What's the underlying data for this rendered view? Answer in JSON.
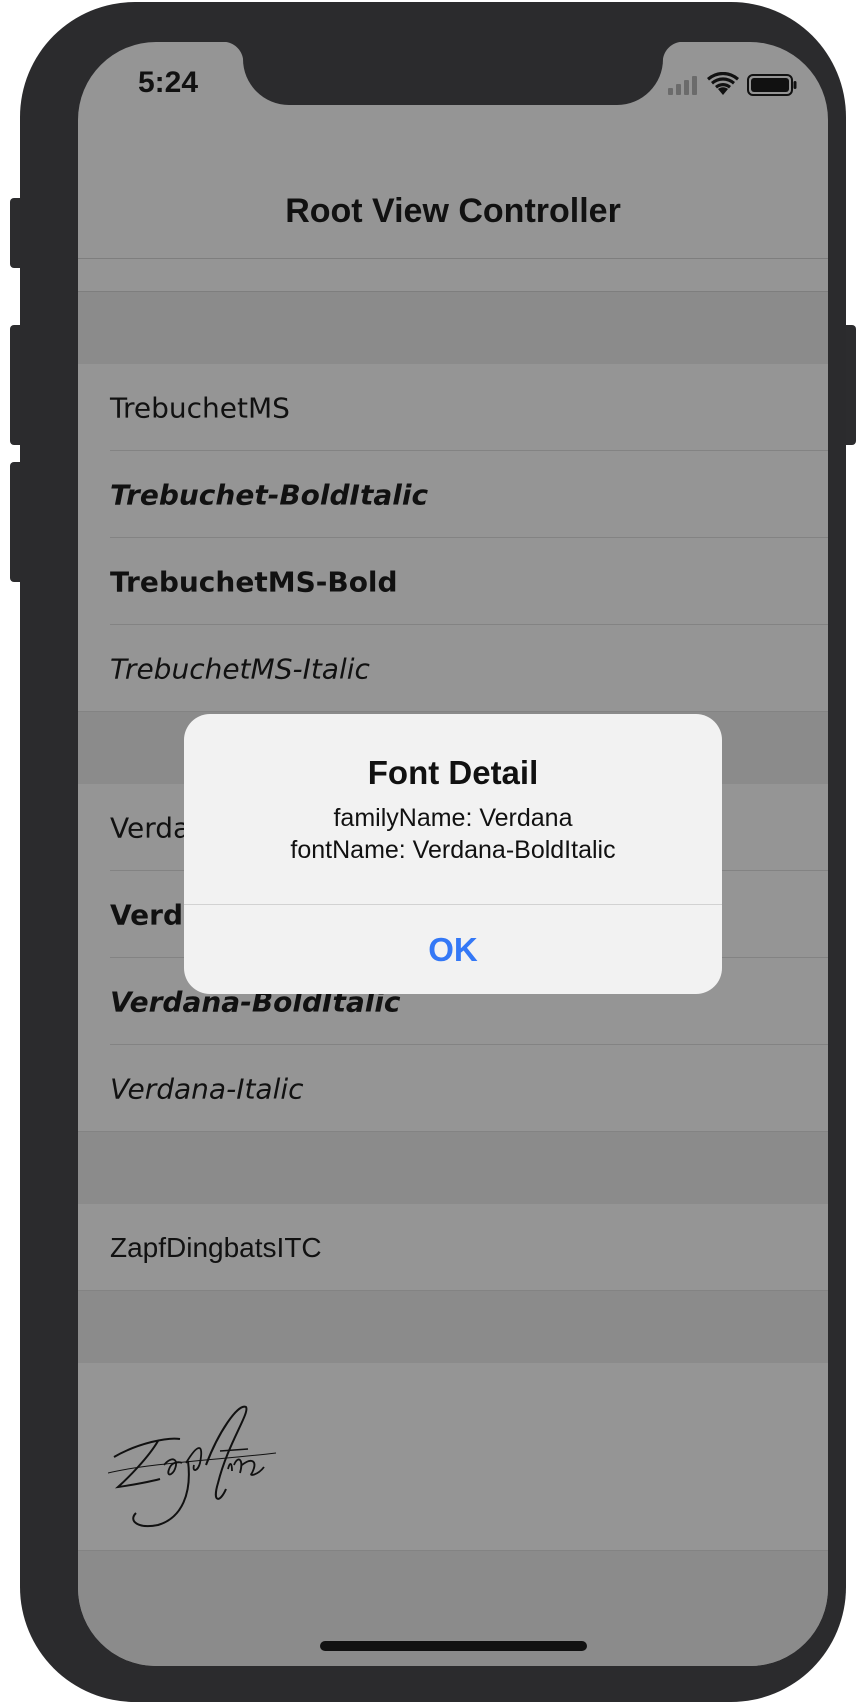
{
  "status_bar": {
    "time": "5:24"
  },
  "navbar": {
    "title": "Root View Controller"
  },
  "sections": [
    {
      "rows": [
        {
          "label": "TrebuchetMS"
        },
        {
          "label": "Trebuchet-BoldItalic"
        },
        {
          "label": "TrebuchetMS-Bold"
        },
        {
          "label": "TrebuchetMS-Italic"
        }
      ]
    },
    {
      "rows": [
        {
          "label": "Verdana"
        },
        {
          "label": "Verdana-Bold"
        },
        {
          "label": "Verdana-BoldItalic"
        },
        {
          "label": "Verdana-Italic"
        }
      ]
    },
    {
      "rows": [
        {
          "label": "ZapfDingbatsITC"
        }
      ]
    },
    {
      "rows": [
        {
          "label": "Zapfino"
        }
      ]
    }
  ],
  "alert": {
    "title": "Font Detail",
    "message_line1": "familyName: Verdana",
    "message_line2": "fontName: Verdana-BoldItalic",
    "ok_label": "OK"
  },
  "colors": {
    "accent": "#3478f6",
    "dim_background": "#959595"
  },
  "icons": [
    "signal-icon",
    "wifi-icon",
    "battery-icon"
  ]
}
